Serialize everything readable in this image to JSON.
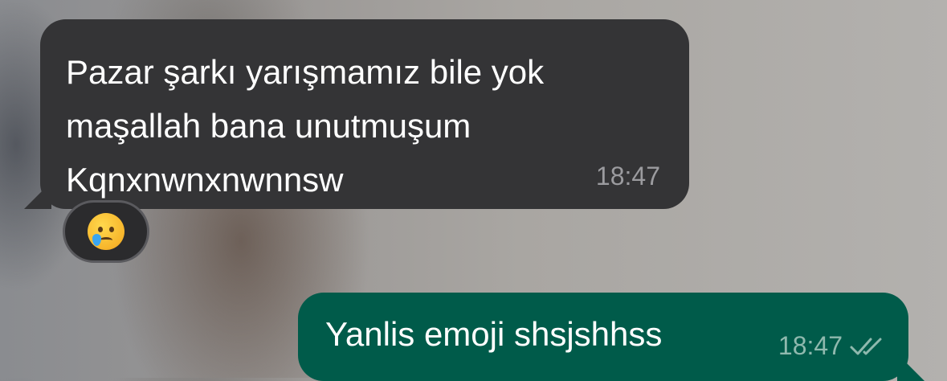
{
  "conversation": {
    "incoming_message": {
      "text": "Pazar şarkı yarışmamız  bile yok\nmaşallah bana unutmuşum\nKqnxnwnxnwnnsw",
      "time": "18:47",
      "reaction": {
        "emoji_name": "crying-face-icon",
        "emoji": "😢"
      }
    },
    "outgoing_message": {
      "text": "Yanlis emoji shsjshhss",
      "time": "18:47",
      "status_icon": "double-check-icon"
    }
  },
  "colors": {
    "incoming_bubble": "#343436",
    "outgoing_bubble": "#005b4a",
    "timestamp_in": "#9b9b9f",
    "timestamp_out": "#8fb9ae",
    "reaction_bg": "#2b2b2d"
  }
}
